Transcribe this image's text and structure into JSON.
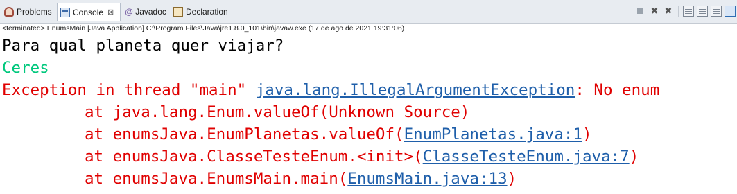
{
  "tabs": [
    {
      "label": "Problems",
      "icon": "problems-icon",
      "active": false
    },
    {
      "label": "Console",
      "icon": "console-icon",
      "active": true,
      "close": "⊠"
    },
    {
      "label": "Javadoc",
      "icon": "javadoc-at-icon",
      "active": false
    },
    {
      "label": "Declaration",
      "icon": "declaration-icon",
      "active": false
    }
  ],
  "toolbar": {
    "icons": [
      "terminate-icon",
      "remove-launch-icon",
      "remove-all-terminated-icon",
      "scroll-lock-icon",
      "word-wrap-icon",
      "pin-console-icon",
      "display-selected-console-icon"
    ]
  },
  "status_line": "<terminated> EnumsMain [Java Application] C:\\Program Files\\Java\\jre1.8.0_101\\bin\\javaw.exe (17 de ago de 2021 19:31:06)",
  "console": {
    "prompt": "Para qual planeta quer viajar?",
    "input": "Ceres",
    "exception_prefix": "Exception in thread \"main\" ",
    "exception_class": "java.lang.IllegalArgumentException",
    "exception_suffix": ": No enum",
    "trace": [
      {
        "prefix": "\tat java.lang.Enum.valueOf(Unknown Source)",
        "link": "",
        "suffix": ""
      },
      {
        "prefix": "\tat enumsJava.EnumPlanetas.valueOf(",
        "link": "EnumPlanetas.java:1",
        "suffix": ")"
      },
      {
        "prefix": "\tat enumsJava.ClasseTesteEnum.<init>(",
        "link": "ClasseTesteEnum.java:7",
        "suffix": ")"
      },
      {
        "prefix": "\tat enumsJava.EnumsMain.main(",
        "link": "EnumsMain.java:13",
        "suffix": ")"
      }
    ]
  },
  "colors": {
    "stdout": "#000000",
    "stdin": "#00c87d",
    "stderr": "#e00000",
    "link": "#1f5faa"
  }
}
